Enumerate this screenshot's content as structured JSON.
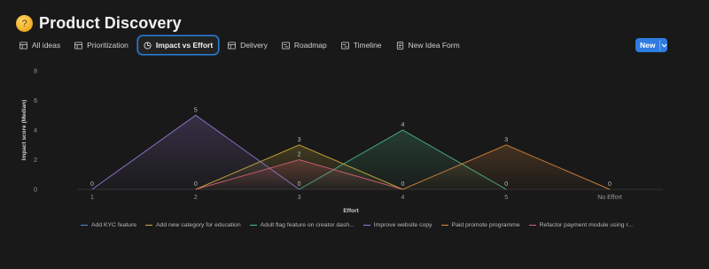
{
  "header": {
    "title": "Product Discovery",
    "emoji": "thinking-face"
  },
  "tabs": [
    {
      "label": "All ideas",
      "icon": "table-icon",
      "active": false
    },
    {
      "label": "Prioritization",
      "icon": "table-icon",
      "active": false
    },
    {
      "label": "Impact vs Effort",
      "icon": "chart-icon",
      "active": true
    },
    {
      "label": "Delivery",
      "icon": "table-icon",
      "active": false
    },
    {
      "label": "Roadmap",
      "icon": "timeline-icon",
      "active": false
    },
    {
      "label": "Timeline",
      "icon": "timeline-icon",
      "active": false
    },
    {
      "label": "New Idea Form",
      "icon": "form-icon",
      "active": false
    }
  ],
  "toolbar": {
    "new_label": "New"
  },
  "chart_data": {
    "type": "area",
    "xlabel": "Effort",
    "ylabel": "Impact score (Median)",
    "categories": [
      "1",
      "2",
      "3",
      "4",
      "5",
      "No Effort"
    ],
    "ylim": [
      0,
      8
    ],
    "yticks": [
      0,
      2,
      4,
      6,
      8
    ],
    "grid": "baseline only",
    "legend": "bottom",
    "series": [
      {
        "name": "Add KYC feature",
        "color": "#4a90d9",
        "values": [
          null,
          null,
          null,
          null,
          null,
          null
        ]
      },
      {
        "name": "Add new category for education",
        "color": "#d4b23a",
        "values": [
          null,
          0,
          3,
          0,
          null,
          null
        ]
      },
      {
        "name": "Adult flag feature on creator dash...",
        "color": "#4fbf8a",
        "values": [
          null,
          null,
          0,
          4,
          0,
          null
        ]
      },
      {
        "name": "Improve website copy",
        "color": "#9b7fe0",
        "values": [
          0,
          5,
          0,
          null,
          null,
          null
        ]
      },
      {
        "name": "Paid promote programme",
        "color": "#e08a3c",
        "values": [
          null,
          null,
          null,
          0,
          3,
          0
        ]
      },
      {
        "name": "Refactor payment module using r...",
        "color": "#d9647a",
        "values": [
          null,
          0,
          2,
          0,
          null,
          null
        ]
      }
    ]
  }
}
